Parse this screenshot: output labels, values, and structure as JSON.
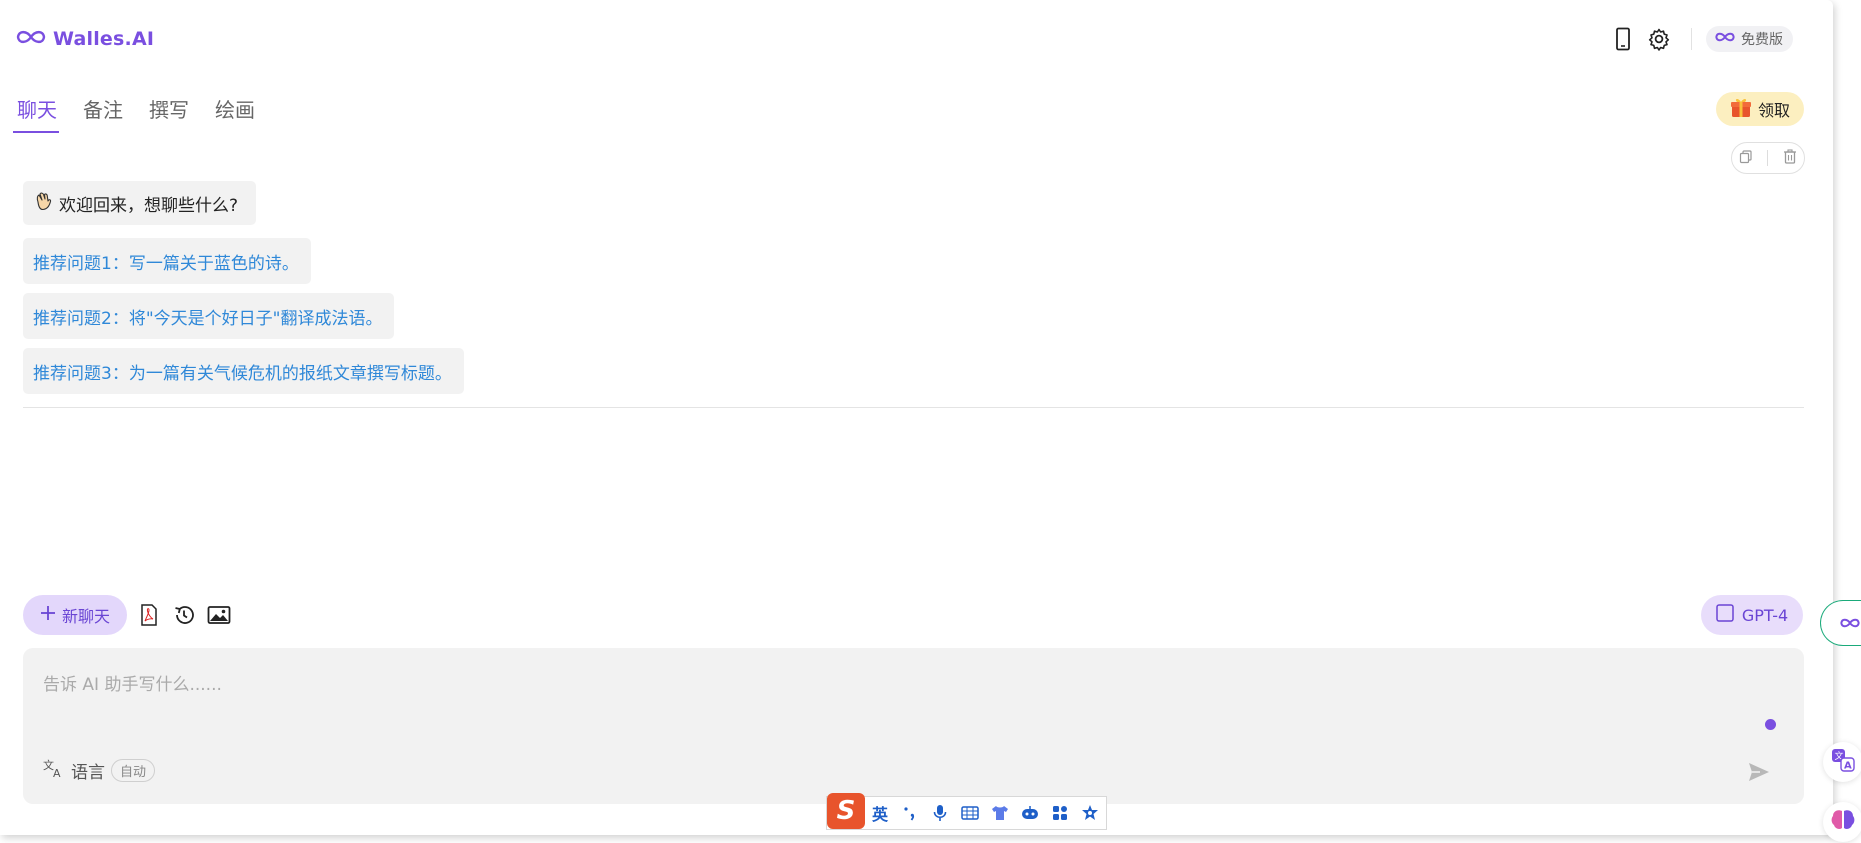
{
  "app": {
    "name": "Walles.AI",
    "plan_badge": "免费版",
    "brand_color": "#7a4fe0"
  },
  "tabs": [
    {
      "label": "聊天",
      "active": true
    },
    {
      "label": "备注",
      "active": false
    },
    {
      "label": "撰写",
      "active": false
    },
    {
      "label": "绘画",
      "active": false
    }
  ],
  "gift_button": {
    "label": "领取"
  },
  "welcome_message": "欢迎回来，想聊些什么?",
  "recommendations": [
    "推荐问题1：写一篇关于蓝色的诗。",
    "推荐问题2：将\"今天是个好日子\"翻译成法语。",
    "推荐问题3：为一篇有关气候危机的报纸文章撰写标题。"
  ],
  "toolbar": {
    "new_chat_label": "新聊天",
    "model_label": "GPT-4"
  },
  "input": {
    "placeholder": "告诉 AI 助手写什么......",
    "value": "",
    "language_label": "语言",
    "language_value": "自动"
  },
  "ime": {
    "mode_label": "英"
  },
  "icons": {
    "logo": "infinity-icon",
    "header": [
      "mobile-phone-icon",
      "gear-icon"
    ],
    "message_tools": [
      "copy-icon",
      "trash-icon"
    ],
    "toolbar": [
      "plus-icon",
      "pdf-icon",
      "history-icon",
      "image-icon"
    ],
    "input": [
      "translate-icon",
      "send-icon"
    ]
  }
}
